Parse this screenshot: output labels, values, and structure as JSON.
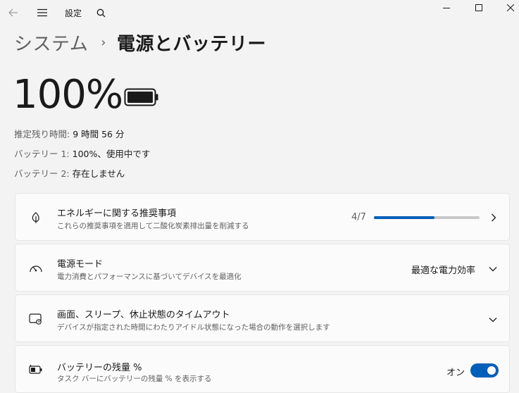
{
  "window": {
    "title": "設定"
  },
  "breadcrumb": {
    "parent": "システム",
    "separator": "›",
    "current": "電源とバッテリー"
  },
  "battery": {
    "percent_text": "100%",
    "level": 1.0,
    "estimate_label": "推定残り時間:",
    "estimate_value": "9 時間 56 分",
    "battery1_label": "バッテリー 1:",
    "battery1_value": "100%、使用中です",
    "battery2_label": "バッテリー 2:",
    "battery2_value": "存在しません"
  },
  "cards": {
    "energy": {
      "title": "エネルギーに関する推奨事項",
      "subtitle": "これらの推奨事項を適用して二酸化炭素排出量を削減する",
      "progress_text": "4/7",
      "progress_fraction": 0.5714
    },
    "power_mode": {
      "title": "電源モード",
      "subtitle": "電力消費とパフォーマンスに基づいてデバイスを最適化",
      "value": "最適な電力効率"
    },
    "screen_sleep": {
      "title": "画面、スリープ、休止状態のタイムアウト",
      "subtitle": "デバイスが指定された時間にわたりアイドル状態になった場合の動作を選択します"
    },
    "battery_percent": {
      "title": "バッテリーの残量 %",
      "subtitle": "タスク バーにバッテリーの残量 % を表示する",
      "toggle_label": "オン",
      "toggle_on": true
    }
  },
  "colors": {
    "accent": "#005fb8",
    "background": "#f3f3f3",
    "card": "#fbfbfb"
  }
}
